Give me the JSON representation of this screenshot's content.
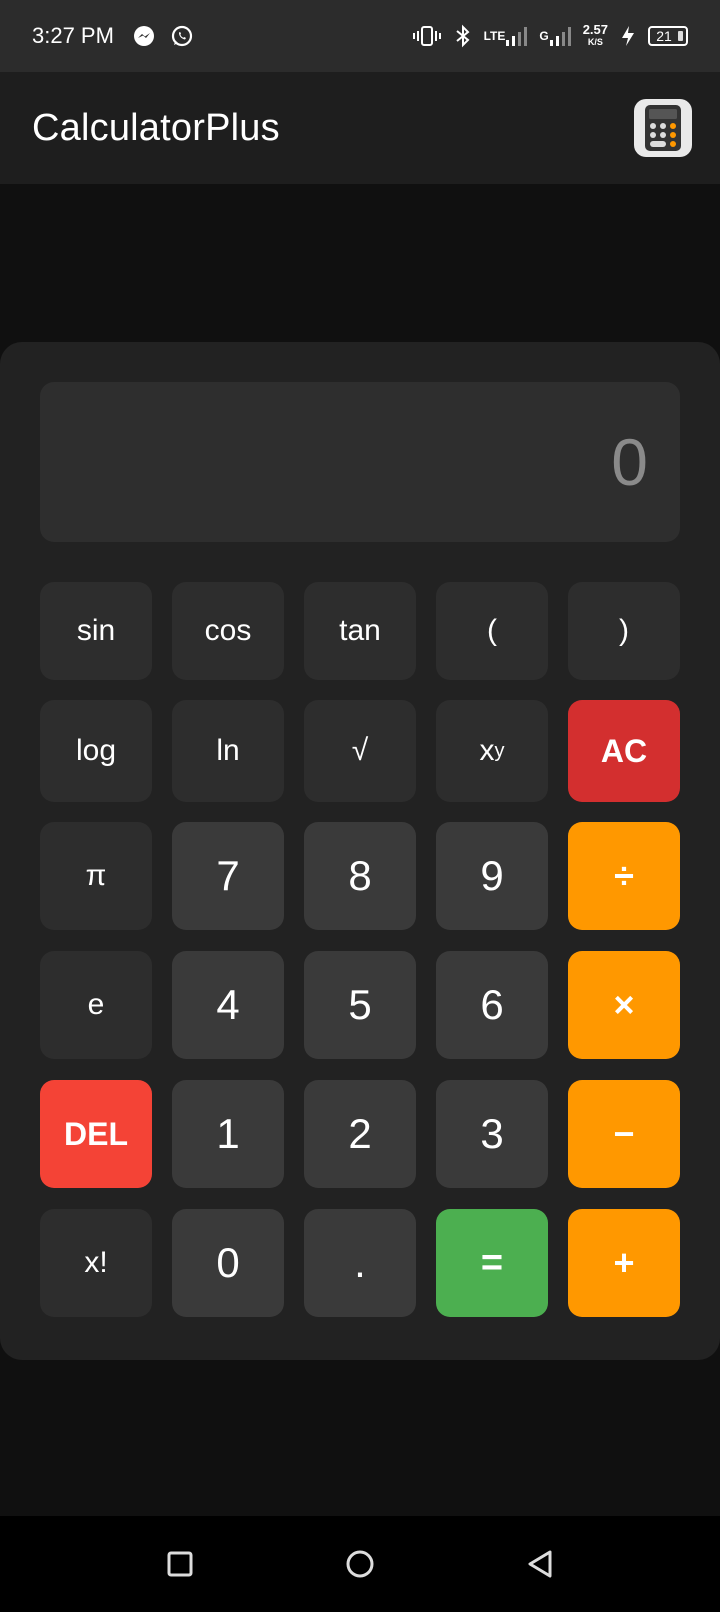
{
  "status_bar": {
    "time": "3:27 PM",
    "network_type": "LTE",
    "network_type_2": "G",
    "speed_value": "2.57",
    "speed_unit": "K/S",
    "battery_level": "21",
    "icons": [
      "messenger-icon",
      "whatsapp-icon",
      "vibrate-icon",
      "bluetooth-icon",
      "signal-icon",
      "charging-icon",
      "battery-icon"
    ]
  },
  "app_bar": {
    "title": "CalculatorPlus",
    "logo_icon": "calculator-icon"
  },
  "display": {
    "value": "0"
  },
  "keypad": {
    "sin": "sin",
    "cos": "cos",
    "tan": "tan",
    "paren_open": "(",
    "paren_close": ")",
    "log": "log",
    "ln": "ln",
    "sqrt": "√",
    "power_base": "x",
    "power_exp": "y",
    "ac": "AC",
    "pi": "π",
    "seven": "7",
    "eight": "8",
    "nine": "9",
    "divide": "÷",
    "e": "e",
    "four": "4",
    "five": "5",
    "six": "6",
    "multiply": "×",
    "del": "DEL",
    "one": "1",
    "two": "2",
    "three": "3",
    "minus": "−",
    "factorial": "x!",
    "zero": "0",
    "dot": ".",
    "equals": "=",
    "plus": "+"
  },
  "colors": {
    "operator": "#ff9800",
    "clear": "#d32f2f",
    "delete": "#f44336",
    "equals": "#4caf50",
    "number_key": "#3a3a3a",
    "function_key": "#2d2d2d"
  },
  "nav_bar": {
    "icons": [
      "recents-square-icon",
      "home-circle-icon",
      "back-triangle-icon"
    ]
  }
}
